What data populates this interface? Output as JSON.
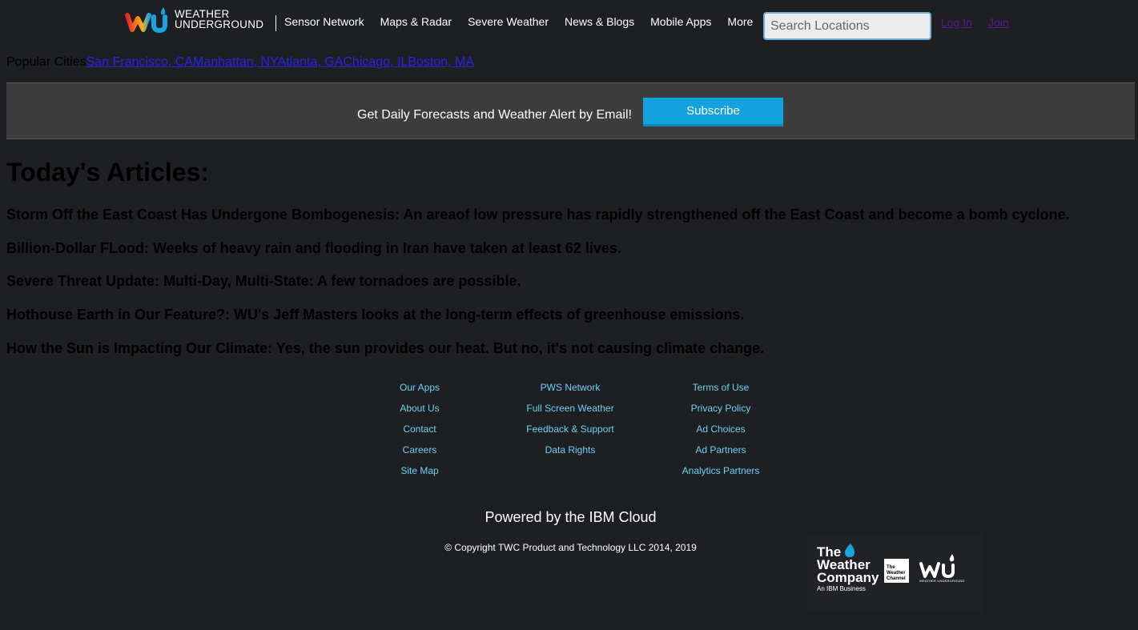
{
  "header": {
    "logo_line1": "WEATHER",
    "logo_line2": "UNDERGROUND",
    "nav": [
      "Sensor Network",
      "Maps & Radar",
      "Severe Weather",
      "News & Blogs",
      "Mobile Apps",
      "More"
    ],
    "search_placeholder": "Search Locations",
    "login": "Log In",
    "join": "Join"
  },
  "popular": {
    "label": "Popular Cities",
    "cities": [
      "San Francisco, CA",
      "Manhattan, NY",
      "Atlanta, GA",
      "Chicago, IL",
      "Boston, MA"
    ]
  },
  "subscribe_band": {
    "text": "Get Daily Forecasts and Weather Alert by Email!",
    "button": "Subscribe"
  },
  "articles": {
    "title": "Today's Articles:",
    "items": [
      "Storm Off the East Coast Has Undergone Bombogenesis: An areaof low pressure has rapidly strengthened off the East Coast and become a bomb cyclone.",
      "Billion-Dollar FLood: Weeks of heavy rain and flooding in Iran have taken at least 62 lives.",
      "Severe Threat Update: Multi-Day, Multi-State: A few tornadoes are possible.",
      "Hothouse Earth in Our Feature?: WU's Jeff Masters looks at the long-term effects of greenhouse emissions.",
      "How the Sun is Impacting Our Climate: Yes, the sun provides our heat. But no, it's not causing climate change."
    ]
  },
  "footer": {
    "col1": [
      "Our Apps",
      "About Us",
      "Contact",
      "Careers",
      "Site Map"
    ],
    "col2": [
      "PWS Network",
      "Full Screen Weather",
      "Feedback & Support",
      "Data Rights"
    ],
    "col3": [
      "Terms of Use",
      "Privacy Policy",
      "Ad Choices",
      "Ad Partners",
      "Analytics Partners"
    ],
    "powered": "Powered by the IBM Cloud",
    "copyright": "© Copyright TWC Product and Technology LLC 2014, 2019",
    "twc_line1": "The",
    "twc_line2": "Weather",
    "twc_line3": "Company",
    "twc_sub": "An IBM Business",
    "channel_line1": "The",
    "channel_line2": "Weather",
    "channel_line3": "Channel",
    "wu_mini": "WEATHER UNDERGROUND"
  },
  "colors": {
    "background": "#1d1f23",
    "band": "#3c3c3c",
    "subscribe": "#12a3de",
    "footer_link": "#6fd0f2"
  }
}
